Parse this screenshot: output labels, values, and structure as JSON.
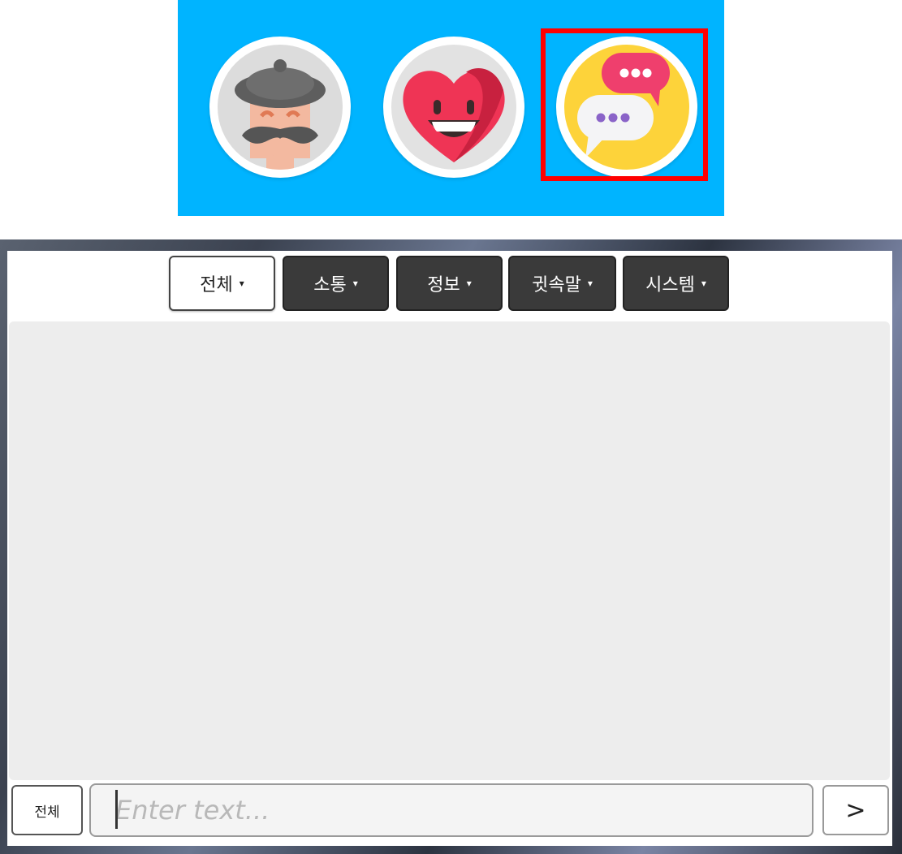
{
  "icon_bar": {
    "background": "#00b4ff",
    "selected_highlight": "#ff0000",
    "buttons": [
      {
        "icon": "artist-avatar-icon",
        "selected": false
      },
      {
        "icon": "heart-emoji-icon",
        "selected": false
      },
      {
        "icon": "chat-bubbles-icon",
        "selected": true
      }
    ]
  },
  "chat": {
    "tabs": [
      {
        "label": "전체",
        "active": true
      },
      {
        "label": "소통",
        "active": false
      },
      {
        "label": "정보",
        "active": false
      },
      {
        "label": "귓속말",
        "active": false
      },
      {
        "label": "시스템",
        "active": false
      }
    ],
    "tab_caret": "▾",
    "channel_button_label": "전체",
    "input": {
      "placeholder": "Enter text...",
      "value": ""
    },
    "send_label": ">",
    "messages": []
  }
}
